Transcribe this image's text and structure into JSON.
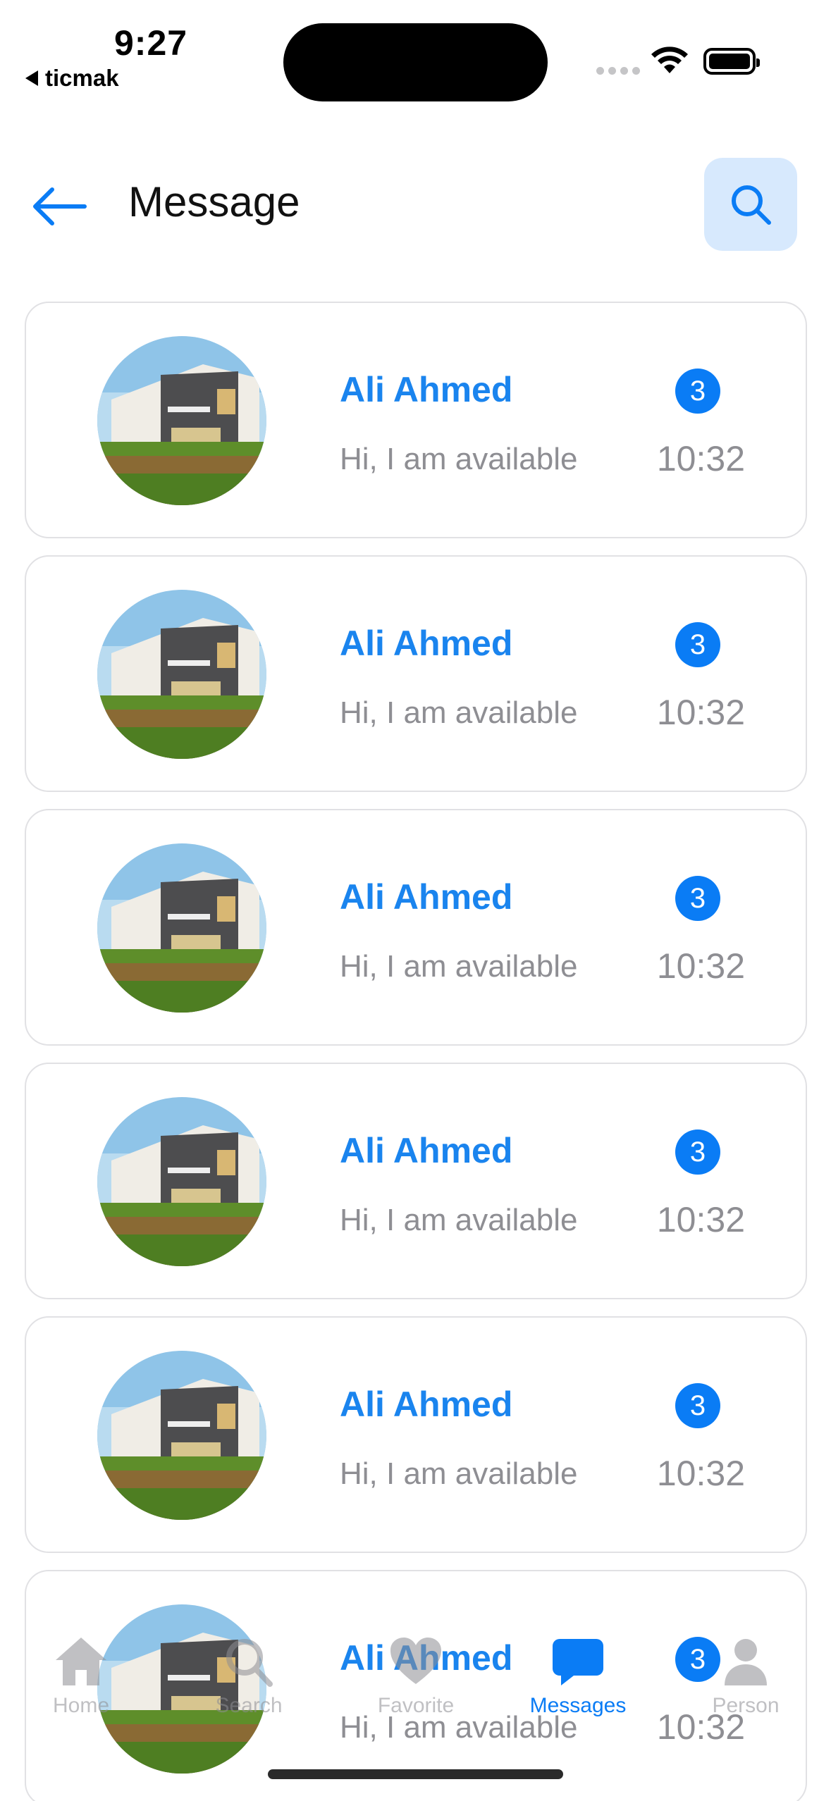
{
  "status_bar": {
    "time": "9:27",
    "back_app": "ticmak"
  },
  "header": {
    "title": "Message",
    "back_icon": "arrow-left-icon",
    "search_icon": "search-icon"
  },
  "colors": {
    "accent": "#0a7cf5",
    "name": "#1a84ee",
    "search_bg": "#d7e9fd",
    "muted": "#8e8e93",
    "card_border": "#e1e1e4"
  },
  "conversations": [
    {
      "name": "Ali Ahmed",
      "preview": "Hi, I am available",
      "time": "10:32",
      "unread": "3"
    },
    {
      "name": "Ali Ahmed",
      "preview": "Hi, I am available",
      "time": "10:32",
      "unread": "3"
    },
    {
      "name": "Ali Ahmed",
      "preview": "Hi, I am available",
      "time": "10:32",
      "unread": "3"
    },
    {
      "name": "Ali Ahmed",
      "preview": "Hi, I am available",
      "time": "10:32",
      "unread": "3"
    },
    {
      "name": "Ali Ahmed",
      "preview": "Hi, I am available",
      "time": "10:32",
      "unread": "3"
    },
    {
      "name": "Ali Ahmed",
      "preview": "Hi, I am available",
      "time": "10:32",
      "unread": "3"
    }
  ],
  "tabbar": {
    "items": [
      {
        "label": "Home",
        "icon": "home-icon"
      },
      {
        "label": "Search",
        "icon": "search-icon"
      },
      {
        "label": "Favorite",
        "icon": "heart-icon"
      },
      {
        "label": "Messages",
        "icon": "chat-bubble-icon",
        "active": true
      },
      {
        "label": "Person",
        "icon": "person-icon"
      }
    ]
  }
}
